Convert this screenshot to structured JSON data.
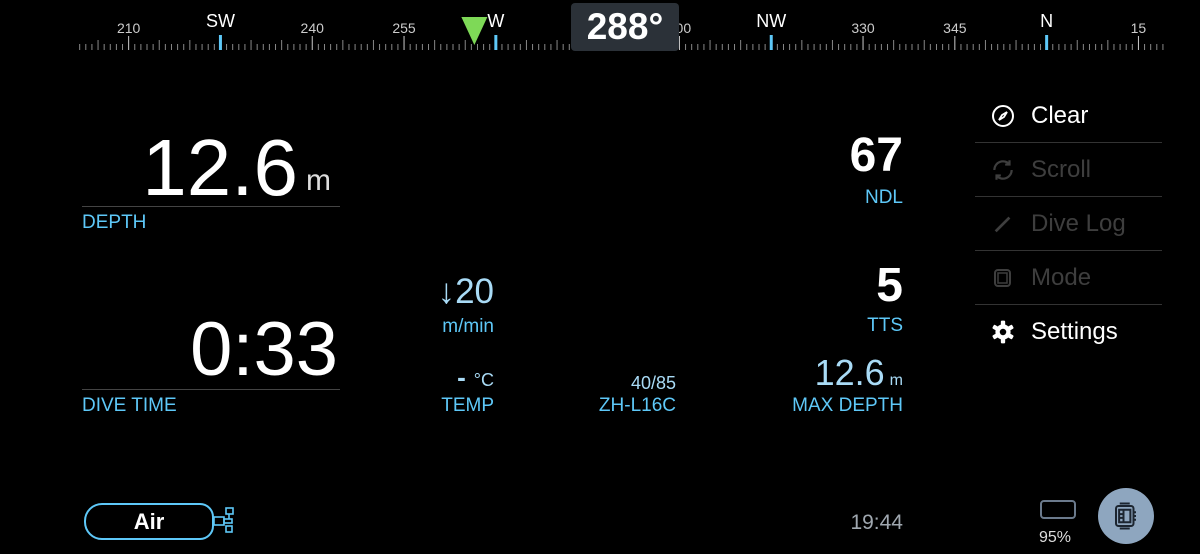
{
  "compass": {
    "heading": 288,
    "heading_label": "288°",
    "scale_labels": [
      {
        "deg": 210,
        "text": "210",
        "cardinal": false
      },
      {
        "deg": 225,
        "text": "SW",
        "cardinal": true
      },
      {
        "deg": 240,
        "text": "240",
        "cardinal": false
      },
      {
        "deg": 255,
        "text": "255",
        "cardinal": false
      },
      {
        "deg": 270,
        "text": "W",
        "cardinal": true
      },
      {
        "deg": 300,
        "text": "300",
        "cardinal": false
      },
      {
        "deg": 315,
        "text": "NW",
        "cardinal": true
      },
      {
        "deg": 330,
        "text": "330",
        "cardinal": false
      },
      {
        "deg": 345,
        "text": "345",
        "cardinal": false
      },
      {
        "deg": 360,
        "text": "N",
        "cardinal": true
      },
      {
        "deg": 375,
        "text": "15",
        "cardinal": false
      }
    ],
    "bearing_marker_deg": 266,
    "marker_color": "#7ed957",
    "cardinal_color": "#5ec8f8"
  },
  "depth": {
    "value": "12.6",
    "unit": "m",
    "label": "DEPTH"
  },
  "dive_time": {
    "value": "0:33",
    "label": "DIVE TIME"
  },
  "ascent_rate": {
    "arrow": "↓",
    "value": "20",
    "unit": "m/min"
  },
  "temp": {
    "value": "-",
    "unit": "°C",
    "label": "TEMP"
  },
  "algorithm": {
    "gf": "40/85",
    "name": "ZH-L16C"
  },
  "ndl": {
    "value": "67",
    "label": "NDL"
  },
  "tts": {
    "value": "5",
    "label": "TTS"
  },
  "max_depth": {
    "value": "12.6",
    "unit": "m",
    "label": "MAX DEPTH"
  },
  "menu": [
    {
      "label": "Clear",
      "icon": "compass-icon",
      "enabled": true
    },
    {
      "label": "Scroll",
      "icon": "refresh-icon",
      "enabled": false
    },
    {
      "label": "Dive Log",
      "icon": "pencil-icon",
      "enabled": false
    },
    {
      "label": "Mode",
      "icon": "watch-icon",
      "enabled": false
    },
    {
      "label": "Settings",
      "icon": "gear-icon",
      "enabled": true
    }
  ],
  "gas": {
    "label": "Air"
  },
  "clock": "19:44",
  "battery": {
    "percent_label": "95%",
    "level": 0.95
  }
}
